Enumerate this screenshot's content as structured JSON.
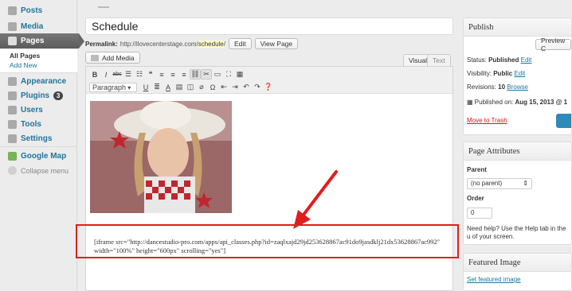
{
  "sidebar": {
    "items": [
      {
        "label": "Posts",
        "icon": "pin-icon"
      },
      {
        "label": "Media",
        "icon": "media-icon"
      },
      {
        "label": "Pages",
        "icon": "pages-icon",
        "current": true
      },
      {
        "label": "Appearance",
        "icon": "appearance-icon"
      },
      {
        "label": "Plugins",
        "icon": "plug-icon",
        "badge": "3"
      },
      {
        "label": "Users",
        "icon": "users-icon"
      },
      {
        "label": "Tools",
        "icon": "tools-icon"
      },
      {
        "label": "Settings",
        "icon": "settings-icon"
      },
      {
        "label": "Google Map",
        "icon": "map-icon"
      }
    ],
    "submenu": {
      "all_pages": "All Pages",
      "add_new": "Add New"
    },
    "collapse": "Collapse menu"
  },
  "editor": {
    "title": "Schedule",
    "permalink_label": "Permalink:",
    "permalink_base": "http://ilovecenterstage.com/",
    "permalink_slug": "schedule",
    "permalink_trail": "/",
    "edit_button": "Edit",
    "view_page_button": "View Page",
    "add_media": "Add Media",
    "tab_visual": "Visual",
    "tab_text": "Text",
    "format_select": "Paragraph",
    "body_text": "[iframe src=\"http://dancestudio-pro.com/apps/api_classes.php?id=zaqlxajd29jd253628867ac91do9jasdklj21dx53628867ac992\" width=\"100%\" height=\"600px\" scrolling=\"yes\"]"
  },
  "publish": {
    "heading": "Publish",
    "preview": "Preview C",
    "status_label": "Status:",
    "status_value": "Published",
    "status_edit": "Edit",
    "visibility_label": "Visibility:",
    "visibility_value": "Public",
    "visibility_edit": "Edit",
    "revisions_label": "Revisions:",
    "revisions_value": "10",
    "revisions_browse": "Browse",
    "published_on_label": "Published on:",
    "published_on_value": "Aug 15, 2013 @ 1",
    "trash": "Move to Trash"
  },
  "page_attributes": {
    "heading": "Page Attributes",
    "parent_label": "Parent",
    "parent_value": "(no parent)",
    "order_label": "Order",
    "order_value": "0",
    "help_text": "Need help? Use the Help tab in the u of your screen."
  },
  "featured_image": {
    "heading": "Featured Image",
    "link": "Set featured image"
  },
  "colors": {
    "annotation": "#e01e1e",
    "link": "#21759b",
    "primary_button": "#2e8ab8"
  }
}
